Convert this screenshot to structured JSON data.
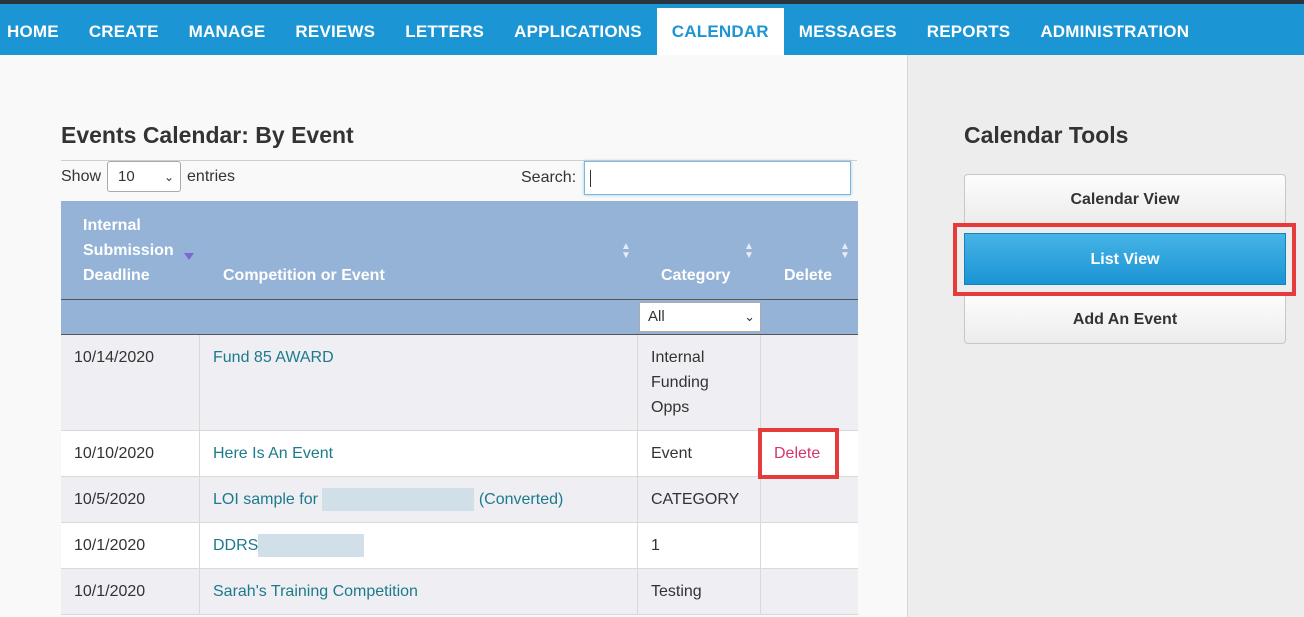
{
  "nav": {
    "items": [
      "HOME",
      "CREATE",
      "MANAGE",
      "REVIEWS",
      "LETTERS",
      "APPLICATIONS",
      "CALENDAR",
      "MESSAGES",
      "REPORTS",
      "ADMINISTRATION"
    ],
    "active": "CALENDAR"
  },
  "page": {
    "title": "Events Calendar: By Event"
  },
  "length": {
    "show_label": "Show",
    "value": "10",
    "entries_label": "entries"
  },
  "search": {
    "label": "Search:",
    "value": ""
  },
  "table": {
    "headers": {
      "deadline": [
        "Internal",
        "Submission",
        "Deadline"
      ],
      "event": "Competition or Event",
      "category": "Category",
      "delete": "Delete"
    },
    "category_filter": "All",
    "rows": [
      {
        "date": "10/14/2020",
        "event": "Fund 85 AWARD",
        "event_suffix": "",
        "category": "Internal Funding Opps",
        "delete": ""
      },
      {
        "date": "10/10/2020",
        "event": "Here Is An Event",
        "event_suffix": "",
        "category": "Event",
        "delete": "Delete"
      },
      {
        "date": "10/5/2020",
        "event": "LOI sample for",
        "event_suffix": "(Converted)",
        "category": "CATEGORY",
        "delete": ""
      },
      {
        "date": "10/1/2020",
        "event": "DDRS",
        "event_suffix": "",
        "category": "1",
        "delete": ""
      },
      {
        "date": "10/1/2020",
        "event": "Sarah's Training Competition",
        "event_suffix": "",
        "category": "Testing",
        "delete": ""
      }
    ]
  },
  "sidebar": {
    "title": "Calendar Tools",
    "buttons": {
      "calendar_view": "Calendar View",
      "list_view": "List View",
      "add_event": "Add An Event"
    }
  },
  "colors": {
    "nav_bg": "#1b95d3",
    "header_bg": "#94b3d7",
    "link": "#1d7a8c",
    "delete": "#d9336c",
    "highlight": "#e53b3b"
  }
}
